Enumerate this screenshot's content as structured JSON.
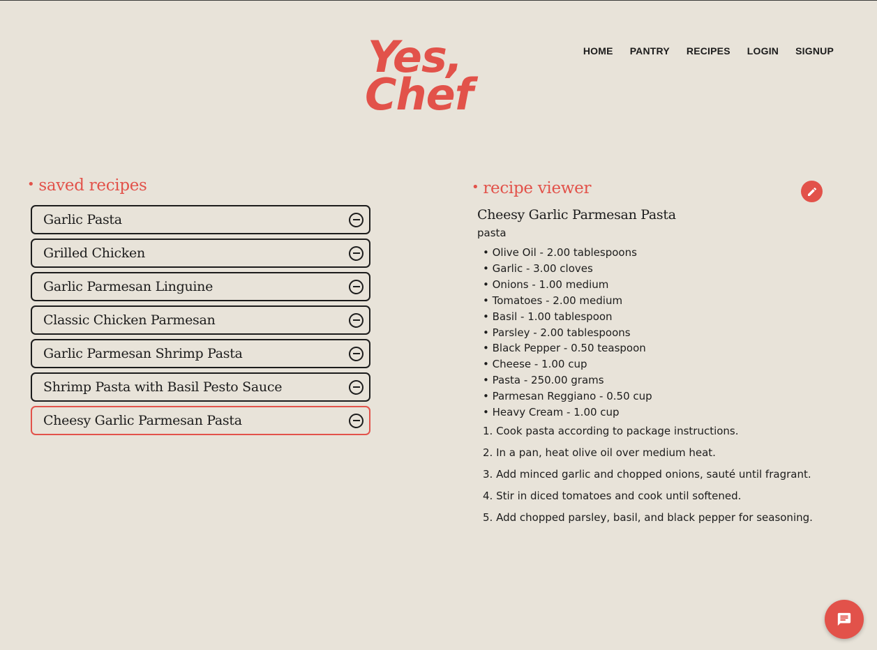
{
  "brand": {
    "logo_line1": "Yes,",
    "logo_line2": "Chef"
  },
  "nav": {
    "home": "HOME",
    "pantry": "PANTRY",
    "recipes": "RECIPES",
    "login": "LOGIN",
    "signup": "SIGNUP"
  },
  "saved": {
    "title": "saved recipes",
    "items": [
      "Garlic Pasta",
      "Grilled Chicken",
      "Garlic Parmesan Linguine",
      "Classic Chicken Parmesan",
      "Garlic Parmesan Shrimp Pasta",
      "Shrimp Pasta with Basil Pesto Sauce",
      "Cheesy Garlic Parmesan Pasta"
    ],
    "active_index": 6
  },
  "viewer": {
    "title": "recipe viewer",
    "recipe_title": "Cheesy Garlic Parmesan Pasta",
    "category": "pasta",
    "ingredients": [
      "Olive Oil - 2.00 tablespoons",
      "Garlic - 3.00 cloves",
      "Onions - 1.00 medium",
      "Tomatoes - 2.00 medium",
      "Basil - 1.00 tablespoon",
      "Parsley - 2.00 tablespoons",
      "Black Pepper - 0.50 teaspoon",
      "Cheese - 1.00 cup",
      "Pasta - 250.00 grams",
      "Parmesan Reggiano - 0.50 cup",
      "Heavy Cream - 1.00 cup"
    ],
    "steps": [
      "1. Cook pasta according to package instructions.",
      "2. In a pan, heat olive oil over medium heat.",
      "3. Add minced garlic and chopped onions, sauté until fragrant.",
      "4. Stir in diced tomatoes and cook until softened.",
      "5. Add chopped parsley, basil, and black pepper for seasoning."
    ]
  },
  "icons": {
    "edit": "pencil-icon",
    "chat": "chat-icon",
    "remove": "minus-circle-icon"
  },
  "colors": {
    "accent": "#e2524a",
    "background": "#e8e3d9",
    "text": "#1c1c1c"
  }
}
